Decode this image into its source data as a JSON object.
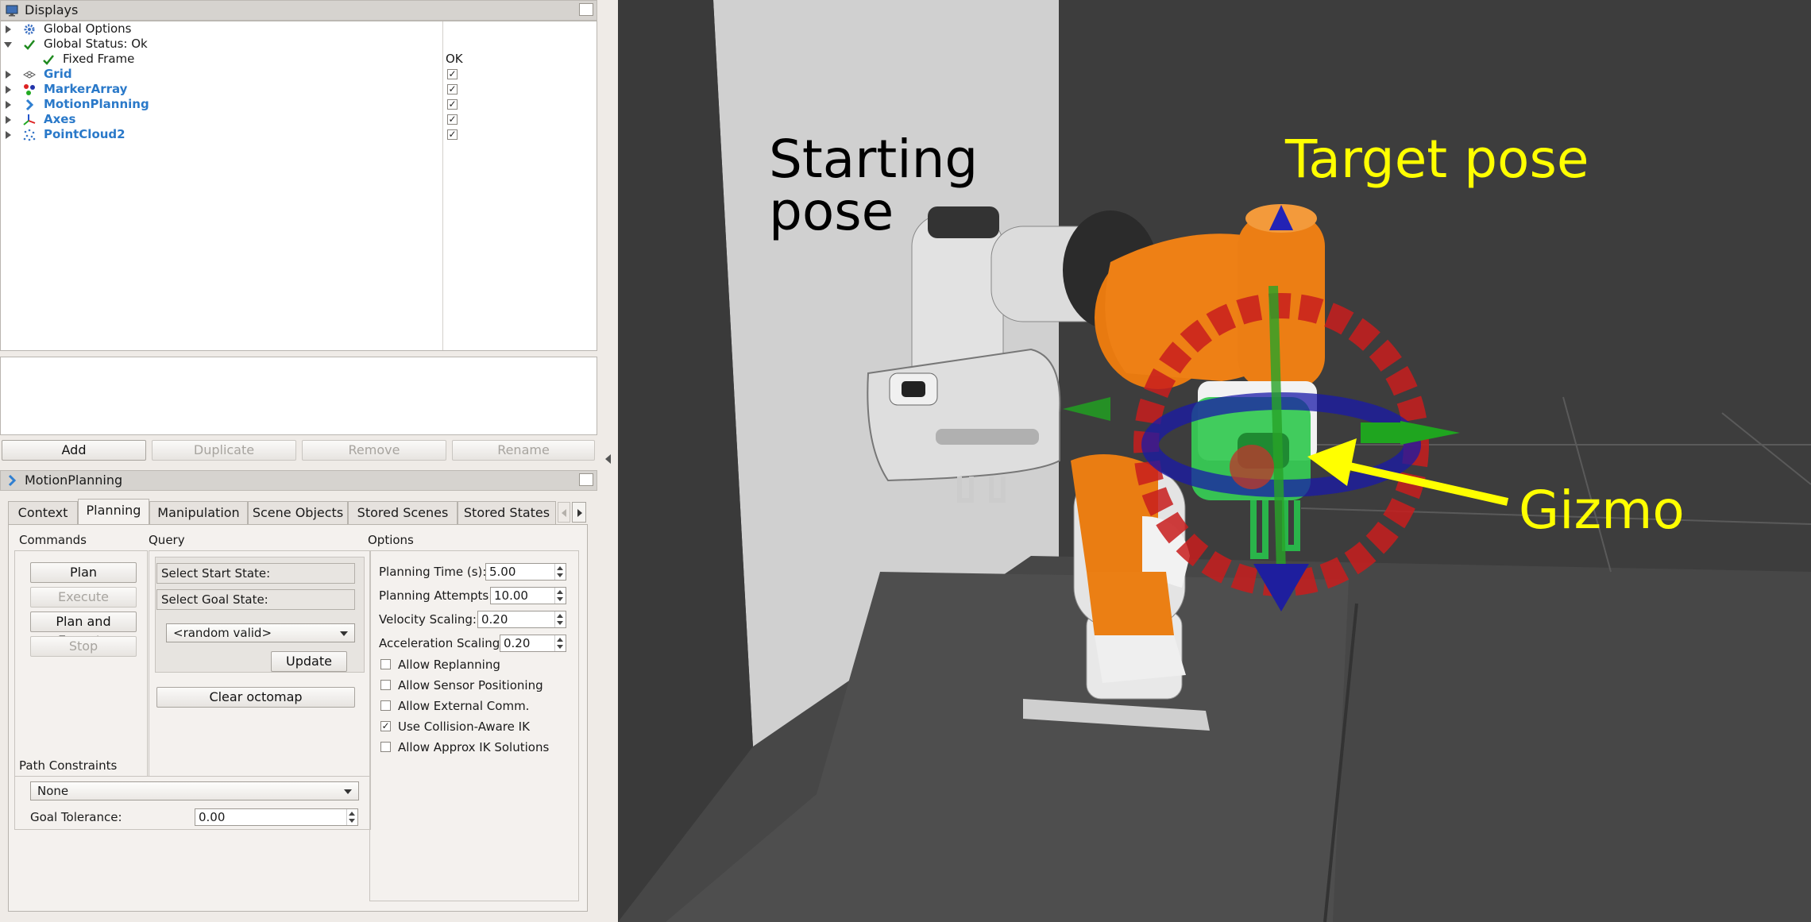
{
  "displays": {
    "title": "Displays",
    "items": [
      {
        "label": "Global Options",
        "value": "",
        "checked": null
      },
      {
        "label": "Global Status: Ok",
        "value": "",
        "checked": null
      },
      {
        "label": "Fixed Frame",
        "value": "OK",
        "checked": null
      },
      {
        "label": "Grid",
        "value": "",
        "checked": true
      },
      {
        "label": "MarkerArray",
        "value": "",
        "checked": true
      },
      {
        "label": "MotionPlanning",
        "value": "",
        "checked": true
      },
      {
        "label": "Axes",
        "value": "",
        "checked": true
      },
      {
        "label": "PointCloud2",
        "value": "",
        "checked": true
      }
    ],
    "buttons": {
      "add": "Add",
      "duplicate": "Duplicate",
      "remove": "Remove",
      "rename": "Rename"
    }
  },
  "motion_planning": {
    "title": "MotionPlanning",
    "tabs": [
      "Context",
      "Planning",
      "Manipulation",
      "Scene Objects",
      "Stored Scenes",
      "Stored States"
    ],
    "active_tab": "Planning",
    "commands": {
      "label": "Commands",
      "plan": "Plan",
      "execute": "Execute",
      "plan_and_execute": "Plan and Execute",
      "stop": "Stop"
    },
    "query": {
      "label": "Query",
      "select_start_state": "Select Start State:",
      "select_goal_state": "Select Goal State:",
      "goal_state_value": "<random valid>",
      "update": "Update",
      "clear_octomap": "Clear octomap"
    },
    "options": {
      "label": "Options",
      "planning_time_label": "Planning Time (s):",
      "planning_time": "5.00",
      "planning_attempts_label": "Planning Attempts:",
      "planning_attempts": "10.00",
      "velocity_scaling_label": "Velocity Scaling:",
      "velocity_scaling": "0.20",
      "acceleration_scaling_label": "Acceleration Scaling:",
      "acceleration_scaling": "0.20",
      "checkboxes": [
        {
          "label": "Allow Replanning",
          "checked": false
        },
        {
          "label": "Allow Sensor Positioning",
          "checked": false
        },
        {
          "label": "Allow External Comm.",
          "checked": false
        },
        {
          "label": "Use Collision-Aware IK",
          "checked": true
        },
        {
          "label": "Allow Approx IK Solutions",
          "checked": false
        }
      ]
    },
    "path_constraints": {
      "label": "Path Constraints",
      "value": "None",
      "goal_tolerance_label": "Goal Tolerance:",
      "goal_tolerance": "0.00"
    }
  },
  "viewport": {
    "annotations": {
      "starting_pose_line1": "Starting",
      "starting_pose_line2": "pose",
      "target_pose": "Target pose",
      "gizmo": "Gizmo"
    },
    "colors": {
      "background": "#3c3c3c",
      "ghost_robot": "#e87a10",
      "gripper_highlight": "#2fc24a",
      "annotation_yellow": "#ffff00",
      "ring_red": "#c81d1d",
      "arrow_green": "#1fa51f",
      "arrow_blue": "#1a1aa8"
    }
  }
}
